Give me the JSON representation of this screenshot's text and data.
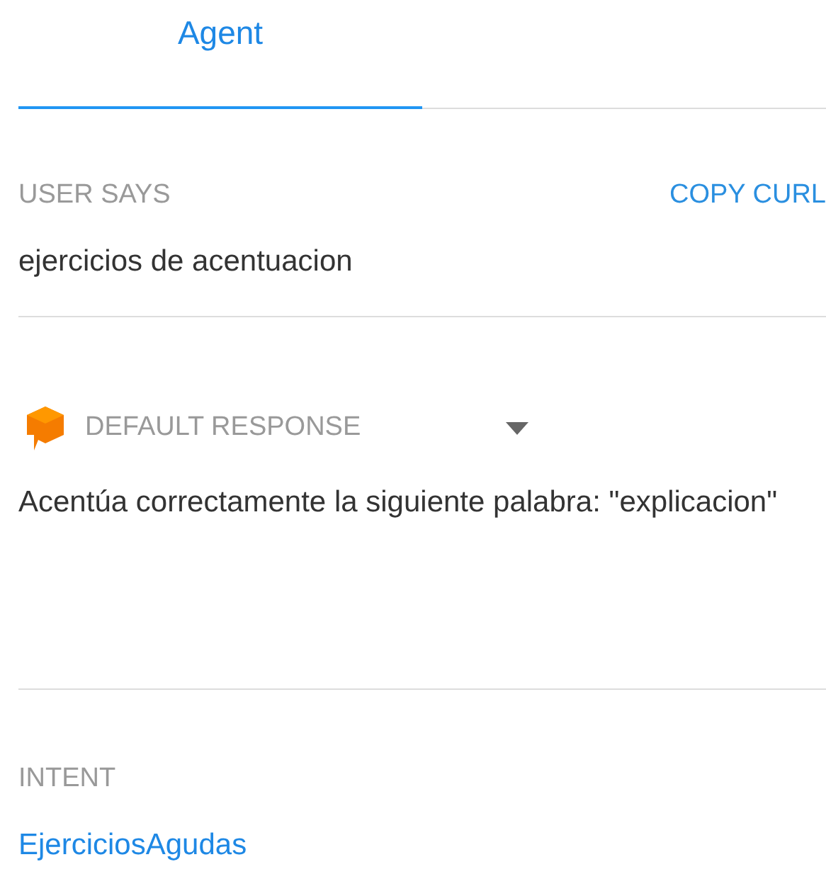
{
  "tabs": [
    {
      "label": "Agent",
      "selected": true
    }
  ],
  "user_says": {
    "label": "USER SAYS",
    "action": "COPY CURL",
    "query": "ejercicios de acentuacion"
  },
  "response": {
    "label": "DEFAULT RESPONSE",
    "expanded": false,
    "text": "Acentúa correctamente la siguiente palabra: \"explicacion\""
  },
  "intent": {
    "label": "INTENT",
    "value": "EjerciciosAgudas"
  }
}
